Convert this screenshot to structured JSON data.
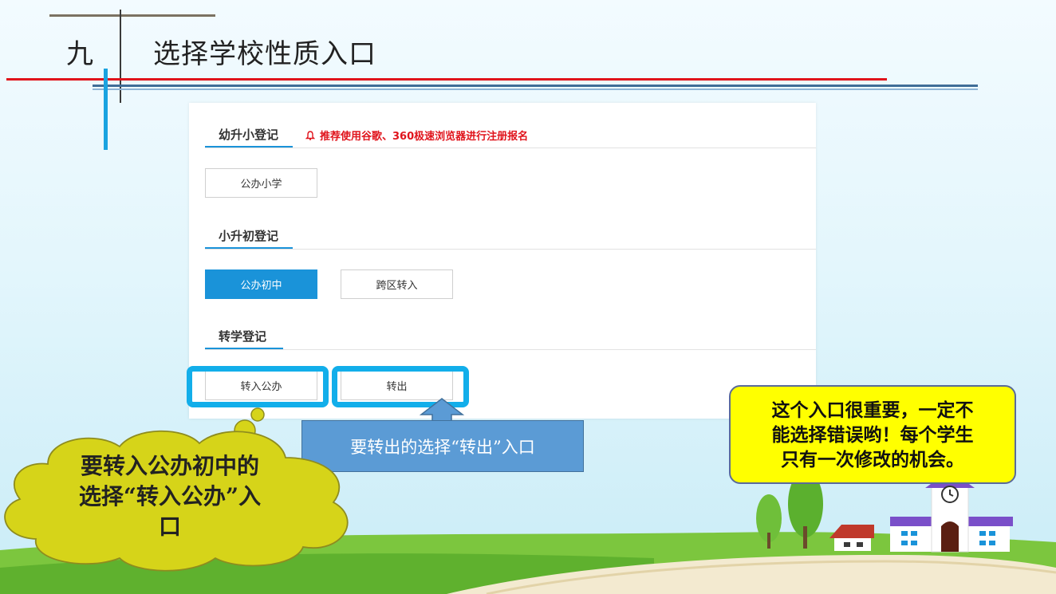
{
  "slide": {
    "number": "九",
    "title": "选择学校性质入口"
  },
  "portal": {
    "sections": [
      {
        "label": "幼升小登记",
        "buttons": [
          "公办小学"
        ]
      },
      {
        "label": "小升初登记",
        "buttons": [
          "公办初中",
          "跨区转入"
        ]
      },
      {
        "label": "转学登记",
        "buttons": [
          "转入公办",
          "转出"
        ]
      }
    ],
    "notice": "推荐使用谷歌、360极速浏览器进行注册报名"
  },
  "callouts": {
    "transfer_out": "要转出的选择“转出”入口",
    "important_lines": [
      "这个入口很重要，一定不",
      "能选择错误哟！每个学生",
      "只有一次修改的机会。"
    ],
    "transfer_in_lines": [
      "要转入公办初中的",
      "选择“转入公办”入",
      "口"
    ]
  },
  "colors": {
    "accent_blue": "#1a93d9",
    "highlight_cyan": "#12aeea",
    "notice_red": "#e0141c",
    "callout_yellow": "#ffff00",
    "cloud_olive": "#d6d419"
  }
}
